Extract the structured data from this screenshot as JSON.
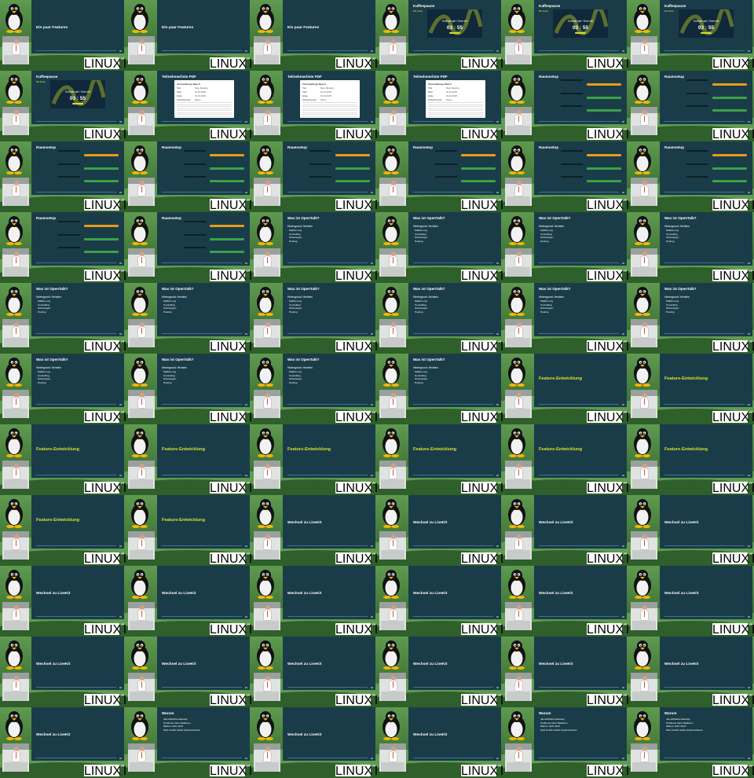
{
  "conference_logo": "LINUXTAGE",
  "badge_text": "25",
  "tiles": [
    {
      "kind": "titled",
      "title": "Ein paar Features"
    },
    {
      "kind": "titled",
      "title": "Ein paar Features"
    },
    {
      "kind": "titled",
      "title": "Ein paar Features"
    },
    {
      "kind": "timer",
      "title": "Kaffeepause",
      "tag": "Bis Ende",
      "caption": "Eröffnet seit / Time left",
      "clock": "03 : 55"
    },
    {
      "kind": "timer",
      "title": "Kaffeepause",
      "tag": "Bis Ende",
      "caption": "Eröffnet seit / Time left",
      "clock": "03 : 55"
    },
    {
      "kind": "timer",
      "title": "Kaffeepause",
      "tag": "Bis Ende",
      "caption": "Eröffnet seit / Time left",
      "clock": "03 : 55"
    },
    {
      "kind": "timer",
      "title": "Kaffeepause",
      "tag": "Bis Ende",
      "caption": "Eröffnet seit / Time left",
      "clock": "03 : 55"
    },
    {
      "kind": "pdf",
      "title": "Teilnehmerliste PDF"
    },
    {
      "kind": "pdf",
      "title": "Teilnehmerliste PDF"
    },
    {
      "kind": "pdf",
      "title": "Teilnehmerliste PDF"
    },
    {
      "kind": "form",
      "title": "Raumsetup"
    },
    {
      "kind": "form",
      "title": "Raumsetup"
    },
    {
      "kind": "form",
      "title": "Raumsetup"
    },
    {
      "kind": "form",
      "title": "Raumsetup"
    },
    {
      "kind": "form",
      "title": "Raumsetup"
    },
    {
      "kind": "form",
      "title": "Raumsetup"
    },
    {
      "kind": "form",
      "title": "Raumsetup"
    },
    {
      "kind": "form",
      "title": "Raumsetup"
    },
    {
      "kind": "form",
      "title": "Raumsetup"
    },
    {
      "kind": "form",
      "title": "Raumsetup"
    },
    {
      "kind": "list",
      "title": "Was ist OpenTalk?"
    },
    {
      "kind": "list",
      "title": "Was ist OpenTalk?"
    },
    {
      "kind": "list",
      "title": "Was ist OpenTalk?"
    },
    {
      "kind": "list",
      "title": "Was ist OpenTalk?"
    },
    {
      "kind": "list",
      "title": "Was ist OpenTalk?"
    },
    {
      "kind": "list",
      "title": "Was ist OpenTalk?"
    },
    {
      "kind": "list",
      "title": "Was ist OpenTalk?"
    },
    {
      "kind": "list",
      "title": "Was ist OpenTalk?"
    },
    {
      "kind": "list",
      "title": "Was ist OpenTalk?"
    },
    {
      "kind": "list",
      "title": "Was ist OpenTalk?"
    },
    {
      "kind": "list",
      "title": "Was ist OpenTalk?"
    },
    {
      "kind": "list",
      "title": "Was ist OpenTalk?"
    },
    {
      "kind": "list",
      "title": "Was ist OpenTalk?"
    },
    {
      "kind": "list",
      "title": "Was ist OpenTalk?"
    },
    {
      "kind": "chapter",
      "title": "Feature-Entwicklung"
    },
    {
      "kind": "chapter",
      "title": "Feature-Entwicklung"
    },
    {
      "kind": "chapter",
      "title": "Feature-Entwicklung"
    },
    {
      "kind": "chapter",
      "title": "Feature-Entwicklung"
    },
    {
      "kind": "chapter",
      "title": "Feature-Entwicklung"
    },
    {
      "kind": "chapter",
      "title": "Feature-Entwicklung"
    },
    {
      "kind": "chapter",
      "title": "Feature-Entwicklung"
    },
    {
      "kind": "chapter",
      "title": "Feature-Entwicklung"
    },
    {
      "kind": "chapter",
      "title": "Feature-Entwicklung"
    },
    {
      "kind": "chapter",
      "title": "Feature-Entwicklung"
    },
    {
      "kind": "titled",
      "title": "Wechsel zu LiveKit"
    },
    {
      "kind": "titled",
      "title": "Wechsel zu LiveKit"
    },
    {
      "kind": "titled",
      "title": "Wechsel zu LiveKit"
    },
    {
      "kind": "titled",
      "title": "Wechsel zu LiveKit"
    },
    {
      "kind": "titled",
      "title": "Wechsel zu LiveKit"
    },
    {
      "kind": "titled",
      "title": "Wechsel zu LiveKit"
    },
    {
      "kind": "titled",
      "title": "Wechsel zu LiveKit"
    },
    {
      "kind": "titled",
      "title": "Wechsel zu LiveKit"
    },
    {
      "kind": "titled",
      "title": "Wechsel zu LiveKit"
    },
    {
      "kind": "titled",
      "title": "Wechsel zu LiveKit"
    },
    {
      "kind": "titled",
      "title": "Wechsel zu LiveKit"
    },
    {
      "kind": "titled",
      "title": "Wechsel zu LiveKit"
    },
    {
      "kind": "titled",
      "title": "Wechsel zu LiveKit"
    },
    {
      "kind": "titled",
      "title": "Wechsel zu LiveKit"
    },
    {
      "kind": "titled",
      "title": "Wechsel zu LiveKit"
    },
    {
      "kind": "titled",
      "title": "Wechsel zu LiveKit"
    },
    {
      "kind": "titled",
      "title": "Wechsel zu LiveKit"
    },
    {
      "kind": "bullets",
      "title": "Warum"
    },
    {
      "kind": "titled",
      "title": "Wechsel zu LiveKit"
    },
    {
      "kind": "titled",
      "title": "Wechsel zu LiveKit"
    },
    {
      "kind": "bullets",
      "title": "Warum"
    },
    {
      "kind": "bullets",
      "title": "Warum"
    }
  ],
  "list_subtitle": "Hintergrund: Heinlein",
  "list_items": [
    "Mailbox.org",
    "Consulting",
    "Schulungen",
    "Hosting"
  ],
  "pdf_rows": [
    {
      "label": "Veranstaltungs-Report",
      "value": ""
    },
    {
      "label": "Titel",
      "value": "Mein Meeting"
    },
    {
      "label": "Start",
      "value": "01.01.2025"
    },
    {
      "label": "Ende",
      "value": "01.01.2025"
    },
    {
      "label": "Teilnehmende",
      "value": "Name"
    }
  ],
  "warum_items": [
    "Janus/Media Gateway",
    "Probleme beim Skalieren",
    "Warum nicht Jitsi?",
    "Weil LiveKit selbst implementieren"
  ],
  "colors": {
    "slide_bg": "#1a3c49",
    "accent_yellow": "#d7e02f",
    "form_orange": "#e69b1a",
    "form_green": "#3aa344"
  }
}
